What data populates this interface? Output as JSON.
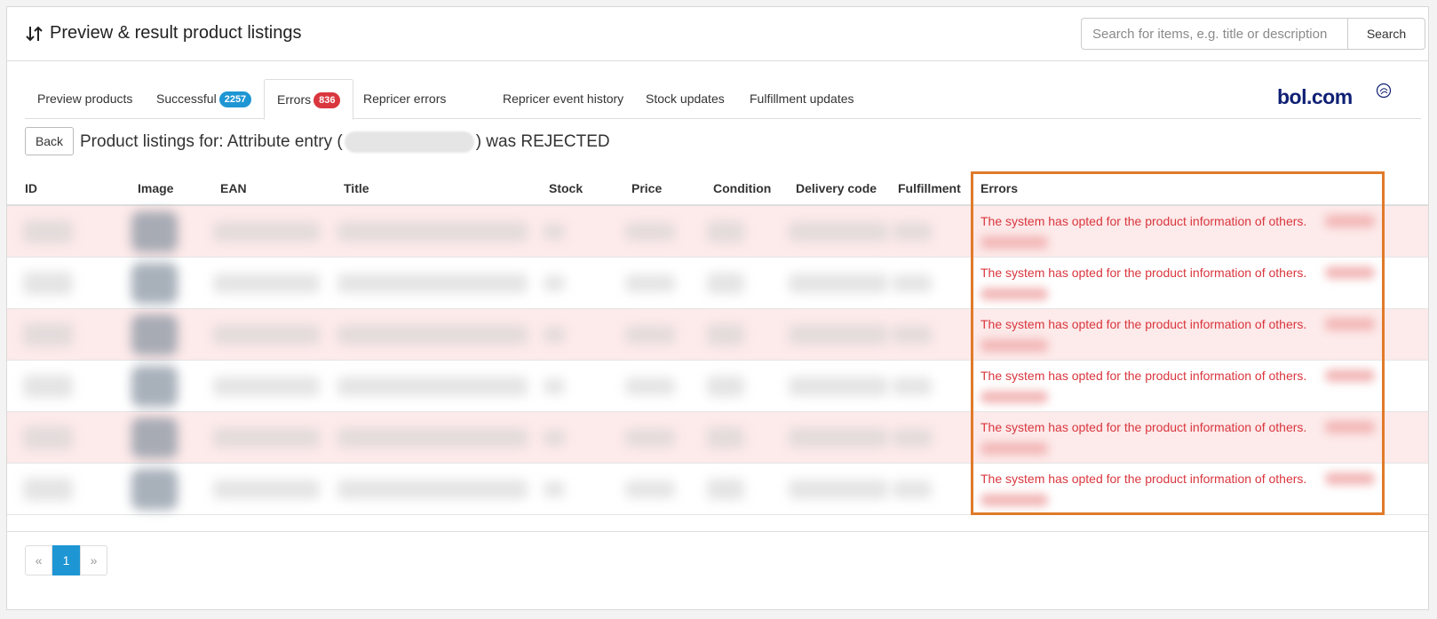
{
  "header": {
    "title": "Preview & result product listings",
    "search_placeholder": "Search for items, e.g. title or description",
    "search_button": "Search"
  },
  "tabs": [
    {
      "label": "Preview products",
      "badge": ""
    },
    {
      "label": "Successful",
      "badge": "2257"
    },
    {
      "label": "Errors",
      "badge": "836"
    },
    {
      "label": "Repricer errors",
      "badge": ""
    },
    {
      "label": "Repricer event history",
      "badge": ""
    },
    {
      "label": "Stock updates",
      "badge": ""
    },
    {
      "label": "Fulfillment updates",
      "badge": ""
    }
  ],
  "logo": "bol.com",
  "back_button": "Back",
  "listing_title": {
    "prefix": "Product listings for: Attribute entry (",
    "suffix": ") was REJECTED"
  },
  "table": {
    "columns": [
      "ID",
      "Image",
      "EAN",
      "Title",
      "Stock",
      "Price",
      "Condition",
      "Delivery code",
      "Fulfillment",
      "Errors"
    ],
    "rows": [
      {
        "error": "The system has opted for the product information of others."
      },
      {
        "error": "The system has opted for the product information of others."
      },
      {
        "error": "The system has opted for the product information of others."
      },
      {
        "error": "The system has opted for the product information of others."
      },
      {
        "error": "The system has opted for the product information of others."
      },
      {
        "error": "The system has opted for the product information of others."
      }
    ]
  },
  "pagination": {
    "prev": "«",
    "current": "1",
    "next": "»"
  },
  "colors": {
    "accent": "#1e96d3",
    "error": "#d9363e",
    "highlight": "#e07b2a",
    "brand": "#0e1f73"
  }
}
